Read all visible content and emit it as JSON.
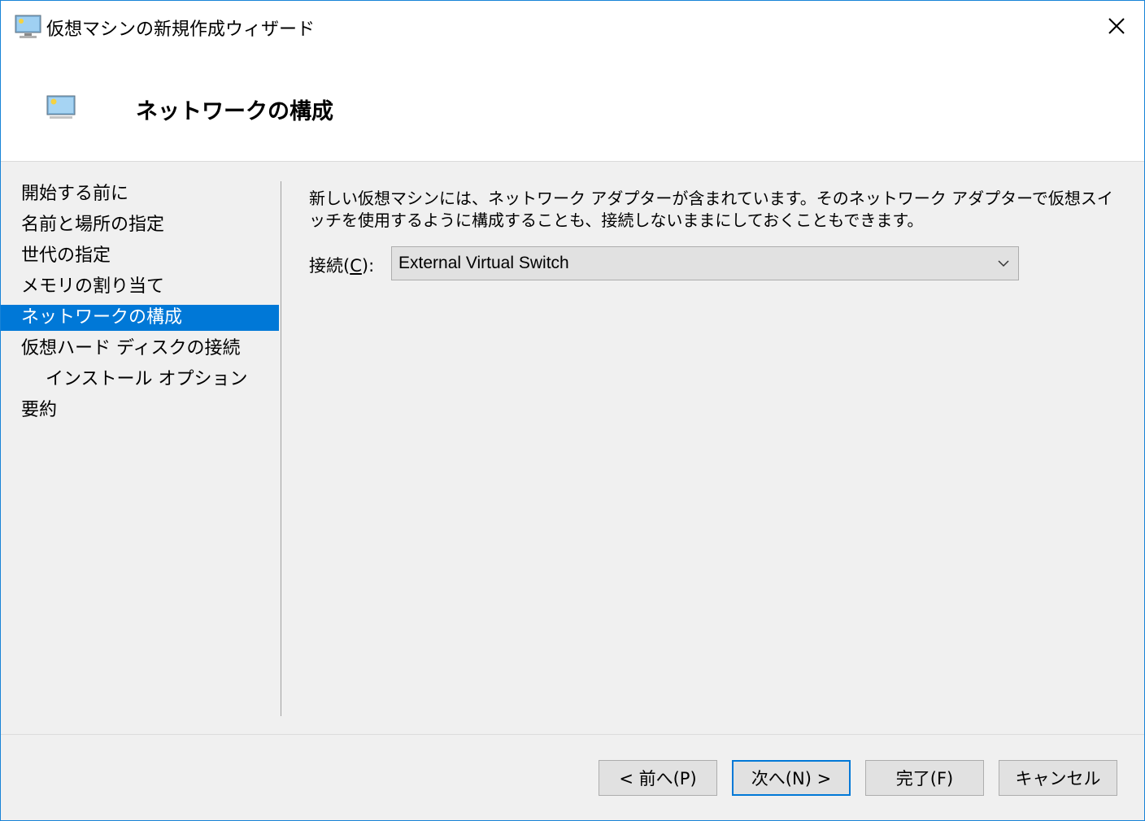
{
  "window": {
    "title": "仮想マシンの新規作成ウィザード",
    "icon": "virtual-machine-icon",
    "accent_color": "#0078d7"
  },
  "header": {
    "title": "ネットワークの構成",
    "icon": "virtual-machine-icon"
  },
  "nav": {
    "items": [
      {
        "label": "開始する前に",
        "selected": false
      },
      {
        "label": "名前と場所の指定",
        "selected": false
      },
      {
        "label": "世代の指定",
        "selected": false
      },
      {
        "label": "メモリの割り当て",
        "selected": false
      },
      {
        "label": "ネットワークの構成",
        "selected": true
      },
      {
        "label": "仮想ハード ディスクの接続",
        "selected": false
      },
      {
        "label": "インストール オプション",
        "selected": false
      },
      {
        "label": "要約",
        "selected": false
      }
    ]
  },
  "main": {
    "description": "新しい仮想マシンには、ネットワーク アダプターが含まれています。そのネットワーク アダプターで仮想スイッチを使用するように構成することも、接続しないままにしておくこともできます。",
    "connection": {
      "label_prefix": "接続(",
      "label_key": "C",
      "label_suffix": "):",
      "selected_value": "External Virtual Switch"
    }
  },
  "footer": {
    "prev_label": "< 前へ(P)",
    "next_label": "次へ(N) >",
    "finish_label": "完了(F)",
    "cancel_label": "キャンセル"
  }
}
